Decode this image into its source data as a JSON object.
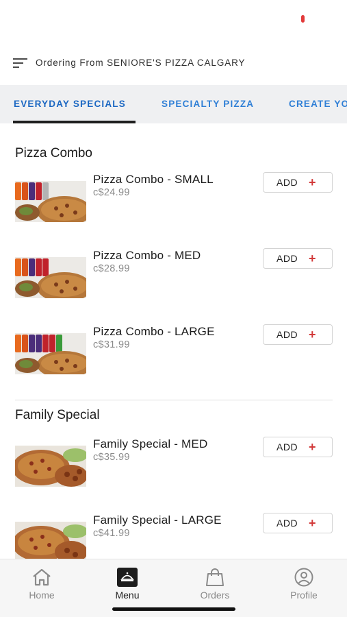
{
  "header": {
    "ordering_text": "Ordering From SENIORE'S PIZZA CALGARY"
  },
  "tabs": [
    {
      "label": "EVERYDAY SPECIALS",
      "active": true
    },
    {
      "label": "SPECIALTY PIZZA",
      "active": false
    },
    {
      "label": "CREATE YO",
      "active": false
    }
  ],
  "sections": [
    {
      "title": "Pizza Combo",
      "items": [
        {
          "name": "Pizza Combo - SMALL",
          "price": "c$24.99",
          "add_label": "ADD",
          "image": "pizza-combo-drinks-image"
        },
        {
          "name": "Pizza Combo - MED",
          "price": "c$28.99",
          "add_label": "ADD",
          "image": "pizza-combo-drinks-image"
        },
        {
          "name": "Pizza Combo - LARGE",
          "price": "c$31.99",
          "add_label": "ADD",
          "image": "pizza-combo-drinks-image"
        }
      ]
    },
    {
      "title": "Family Special",
      "items": [
        {
          "name": "Family Special - MED",
          "price": "c$35.99",
          "add_label": "ADD",
          "image": "family-special-image"
        },
        {
          "name": "Family Special - LARGE",
          "price": "c$41.99",
          "add_label": "ADD",
          "image": "family-special-image"
        }
      ]
    }
  ],
  "bottom_nav": [
    {
      "label": "Home",
      "icon": "home-icon",
      "active": false
    },
    {
      "label": "Menu",
      "icon": "menu-cloche-icon",
      "active": true
    },
    {
      "label": "Orders",
      "icon": "shopping-bag-icon",
      "active": false
    },
    {
      "label": "Profile",
      "icon": "profile-icon",
      "active": false
    }
  ],
  "colors": {
    "accent_blue": "#2f7fd6",
    "add_plus_red": "#d23a3a",
    "tab_bar_bg": "#eff0f2"
  }
}
